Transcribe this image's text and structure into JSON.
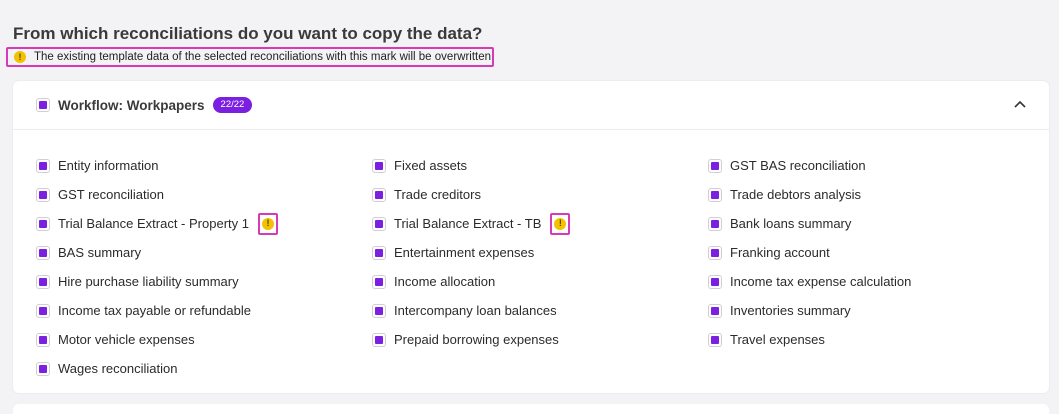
{
  "heading": "From which reconciliations do you want to copy the data?",
  "notice": {
    "icon": "warning-icon",
    "text": "The existing template data of the selected reconciliations with this mark will be overwritten"
  },
  "section": {
    "title": "Workflow: Workpapers",
    "count": "22/22",
    "expanded": true,
    "collapse_icon": "chevron-up-icon"
  },
  "columns": [
    [
      {
        "label": "Entity information",
        "warn": false
      },
      {
        "label": "GST reconciliation",
        "warn": false
      },
      {
        "label": "Trial Balance Extract - Property 1",
        "warn": true
      },
      {
        "label": "BAS summary",
        "warn": false
      },
      {
        "label": "Hire purchase liability summary",
        "warn": false
      },
      {
        "label": "Income tax payable or refundable",
        "warn": false
      },
      {
        "label": "Motor vehicle expenses",
        "warn": false
      },
      {
        "label": "Wages reconciliation",
        "warn": false
      }
    ],
    [
      {
        "label": "Fixed assets",
        "warn": false
      },
      {
        "label": "Trade creditors",
        "warn": false
      },
      {
        "label": "Trial Balance Extract - TB",
        "warn": true
      },
      {
        "label": "Entertainment expenses",
        "warn": false
      },
      {
        "label": "Income allocation",
        "warn": false
      },
      {
        "label": "Intercompany loan balances",
        "warn": false
      },
      {
        "label": "Prepaid borrowing expenses",
        "warn": false
      }
    ],
    [
      {
        "label": "GST BAS reconciliation",
        "warn": false
      },
      {
        "label": "Trade debtors analysis",
        "warn": false
      },
      {
        "label": "Bank loans summary",
        "warn": false
      },
      {
        "label": "Franking account",
        "warn": false
      },
      {
        "label": "Income tax expense calculation",
        "warn": false
      },
      {
        "label": "Inventories summary",
        "warn": false
      },
      {
        "label": "Travel expenses",
        "warn": false
      }
    ]
  ],
  "colors": {
    "accent": "#7b1fe0",
    "highlight": "#d63ab8",
    "warning": "#f2c200"
  }
}
